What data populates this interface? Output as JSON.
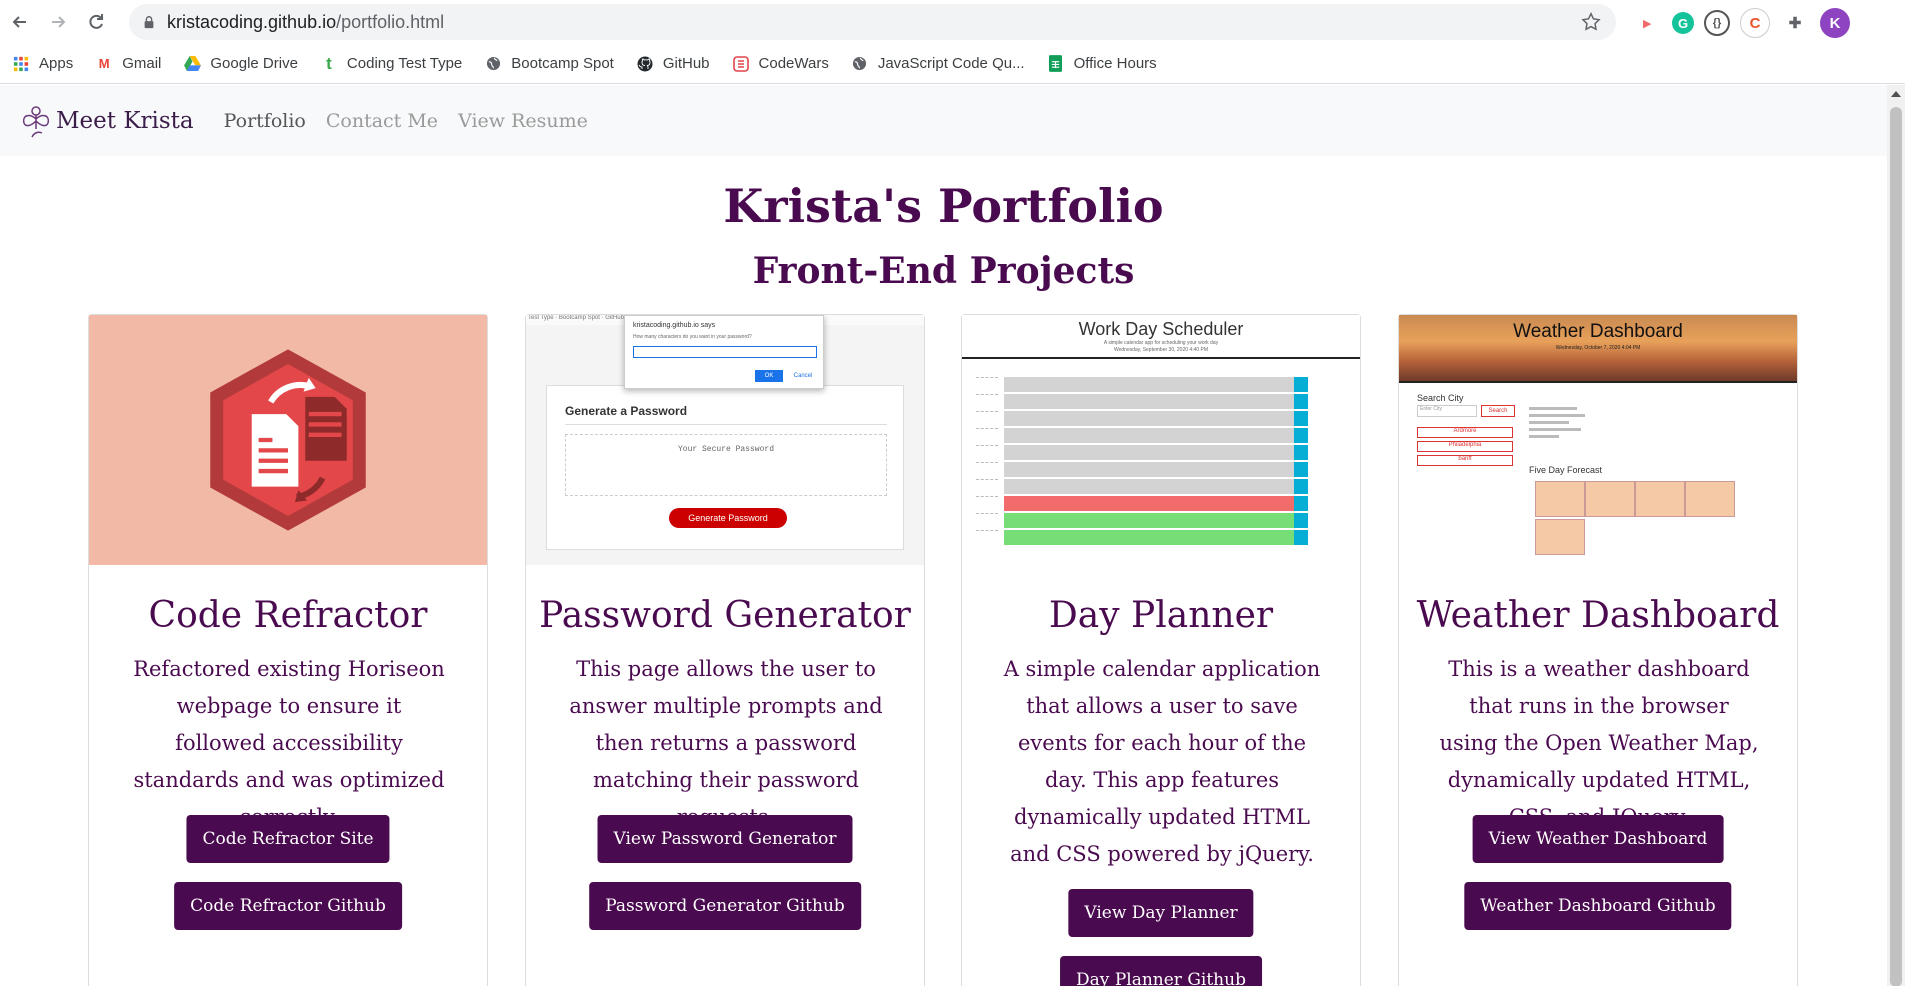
{
  "browser": {
    "url_host": "kristacoding.github.io",
    "url_path": "/portfolio.html",
    "profile_initial": "K",
    "bookmarks": [
      {
        "label": "Apps",
        "icon": "apps-grid-icon"
      },
      {
        "label": "Gmail",
        "icon": "gmail-icon"
      },
      {
        "label": "Google Drive",
        "icon": "google-drive-icon"
      },
      {
        "label": "Coding Test Type",
        "icon": "t-icon"
      },
      {
        "label": "Bootcamp Spot",
        "icon": "globe-icon"
      },
      {
        "label": "GitHub",
        "icon": "github-icon"
      },
      {
        "label": "CodeWars",
        "icon": "codewars-icon"
      },
      {
        "label": "JavaScript Code Qu...",
        "icon": "globe-icon"
      },
      {
        "label": "Office Hours",
        "icon": "sheets-icon"
      }
    ]
  },
  "site": {
    "brand": "Meet Krista",
    "nav": [
      "Portfolio",
      "Contact Me",
      "View Resume"
    ]
  },
  "page": {
    "title": "Krista's Portfolio",
    "subtitle": "Front-End Projects"
  },
  "colors": {
    "accent": "#4a0a4f",
    "refactor_bg": "#f1b9a6"
  },
  "cards": [
    {
      "title": "Code Refractor",
      "text": "Refactored existing Horiseon webpage to ensure it followed accessibility standards and was optimized correctly.",
      "buttons": [
        "Code Refractor Site",
        "Code Refractor Github"
      ]
    },
    {
      "title": "Password Generator",
      "text": "This page allows the user to answer multiple prompts and then returns a password matching their password requests.",
      "buttons": [
        "View Password Generator",
        "Password Generator Github"
      ],
      "preview": {
        "dialog_title": "kristacoding.github.io says",
        "dialog_question": "How many characters do you want in your password?",
        "ok": "OK",
        "cancel": "Cancel",
        "heading": "Generate a Password",
        "placeholder": "Your Secure Password",
        "button": "Generate Password"
      }
    },
    {
      "title": "Day Planner",
      "text": "A simple calendar application that allows a user to save events for each hour of the day. This app features dynamically updated HTML and CSS powered by jQuery.",
      "buttons": [
        "View Day Planner",
        "Day Planner Github"
      ],
      "preview": {
        "heading": "Work Day Scheduler",
        "sub": "A simple calendar app for scheduling your work day",
        "date": "Wednesday, September 30, 2020 4:40 PM"
      }
    },
    {
      "title": "Weather Dashboard",
      "text": "This is a weather dashboard that runs in the browser using the Open Weather Map, dynamically updated HTML, CSS, and JQuery.",
      "buttons": [
        "View Weather Dashboard",
        "Weather Dashboard Github"
      ],
      "preview": {
        "heading": "Weather Dashboard",
        "date": "Wednesday, October 7, 2020 4:04 PM",
        "search_label": "Search City",
        "search_placeholder": "Enter City",
        "search_button": "Search",
        "cities": [
          "Ardmore",
          "Philadelphia",
          "banff"
        ],
        "forecast_label": "Five Day Forecast"
      }
    }
  ]
}
